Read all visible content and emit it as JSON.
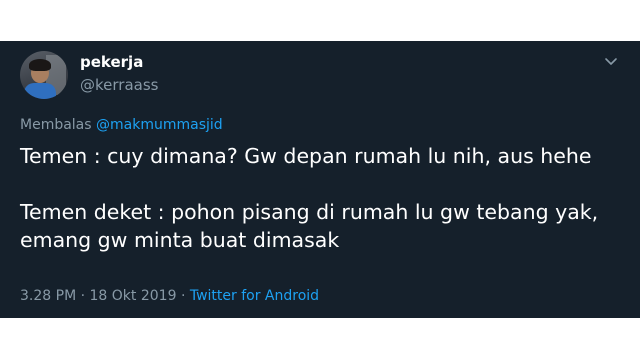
{
  "tweet": {
    "display_name": "pekerja",
    "handle": "@kerraass",
    "reply_prefix": "Membalas",
    "reply_to": "@makmummasjid",
    "paragraphs": [
      "Temen : cuy dimana? Gw depan rumah lu nih, aus hehe",
      "Temen deket : pohon pisang di rumah lu gw tebang yak, emang gw minta buat dimasak"
    ],
    "time": "3.28 PM",
    "date": "18 Okt 2019",
    "separator": "·",
    "source": "Twitter for Android"
  },
  "icons": {
    "menu": "chevron-down-icon",
    "avatar": "profile-photo"
  },
  "colors": {
    "card_background": "#15202b",
    "secondary_text": "#8899a6",
    "link": "#1da1f2",
    "primary_text": "#ffffff"
  }
}
